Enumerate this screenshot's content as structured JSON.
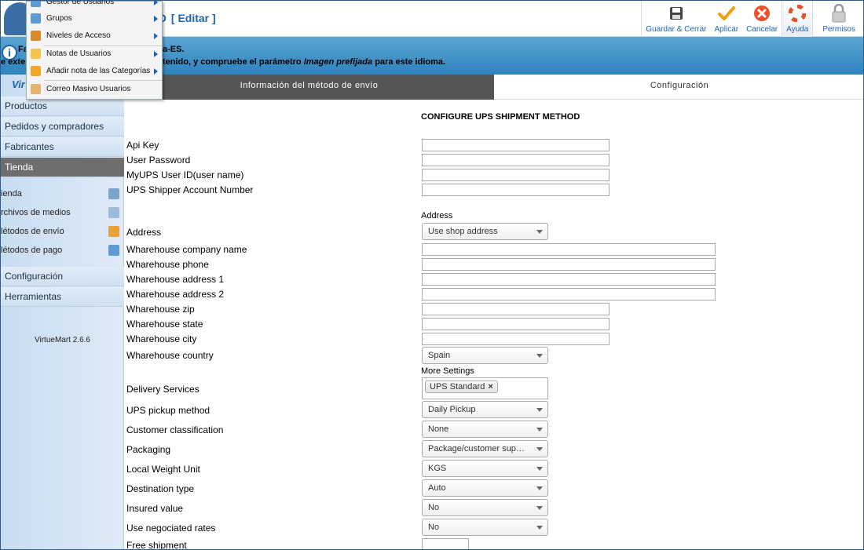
{
  "header": {
    "title_fragment": "O",
    "edit_label": "[ Editar ]"
  },
  "toolbar": {
    "buttons": [
      {
        "label": "Guardar & Cerrar",
        "icon": "save-icon"
      },
      {
        "label": "Aplicar",
        "icon": "check-icon"
      },
      {
        "label": "Cancelar",
        "icon": "cancel-icon"
      },
      {
        "label": "Ayuda",
        "icon": "help-lifebuoy-icon"
      },
      {
        "label": "Permisos",
        "icon": "lock-icon"
      }
    ]
  },
  "message": {
    "frag_line1": "Fa",
    "frag_line2": "e exte",
    "line1": "a-ES.",
    "line2_prefix": "tenido, y compruebe el parámetro ",
    "line2_em": "Imagen prefijada",
    "line2_suffix": " para este idioma."
  },
  "menu": {
    "items": [
      {
        "label": "Gestor de Usuarios",
        "has_submenu": true
      },
      {
        "label": "Grupos",
        "has_submenu": true
      },
      {
        "label": "Niveles de Acceso",
        "has_submenu": true
      },
      {
        "label": "Notas de Usuarios",
        "has_submenu": true
      },
      {
        "label": "Añadir nota de las Categorías",
        "has_submenu": true
      },
      {
        "label": "Correo Masivo Usuarios",
        "has_submenu": false
      }
    ]
  },
  "sidebar": {
    "logo_text": "Vir",
    "items": [
      {
        "label": "Productos"
      },
      {
        "label": "Pedidos y compradores"
      },
      {
        "label": "Fabricantes"
      },
      {
        "label": "Tienda"
      }
    ],
    "sub_items": [
      {
        "label": "ienda",
        "icon": "store-icon"
      },
      {
        "label": "rchivos de medios",
        "icon": "media-icon"
      },
      {
        "label": "létodos de envío",
        "icon": "truck-icon"
      },
      {
        "label": "létodos de pago",
        "icon": "payment-icon"
      }
    ],
    "bottom_items": [
      {
        "label": "Configuración"
      },
      {
        "label": "Herramientas"
      }
    ],
    "version": "VirtueMart 2.6.6"
  },
  "tabs": [
    {
      "label": "Información del método de envío"
    },
    {
      "label": "Configuración"
    }
  ],
  "form": {
    "section_title": "CONFIGURE UPS SHIPMENT METHOD",
    "address_heading": "Address",
    "more_settings_heading": "More Settings",
    "labels": {
      "api_key": "Api Key",
      "user_password": "User Password",
      "myups_user_id": "MyUPS User ID(user name)",
      "shipper_account": "UPS Shipper Account Number",
      "address": "Address",
      "wh_company": "Wharehouse company name",
      "wh_phone": "Wharehouse phone",
      "wh_address1": "Wharehouse address 1",
      "wh_address2": "Wharehouse address 2",
      "wh_zip": "Wharehouse zip",
      "wh_state": "Wharehouse state",
      "wh_city": "Wharehouse city",
      "wh_country": "Wharehouse country",
      "delivery_services": "Delivery Services",
      "pickup_method": "UPS pickup method",
      "customer_class": "Customer classification",
      "packaging": "Packaging",
      "weight_unit": "Local Weight Unit",
      "destination_type": "Destination type",
      "insured_value": "Insured value",
      "negotiated_rates": "Use negociated rates",
      "free_shipment": "Free shipment"
    },
    "values": {
      "address": "Use shop address",
      "wh_country": "Spain",
      "delivery_chip": "UPS Standard",
      "pickup_method": "Daily Pickup",
      "customer_class": "None",
      "packaging": "Package/customer sup…",
      "weight_unit": "KGS",
      "destination_type": "Auto",
      "insured_value": "No",
      "negotiated_rates": "No"
    }
  },
  "colors": {
    "link_blue": "#1c64b4",
    "band_blue": "#2f83bd",
    "active_tab": "#555555"
  }
}
